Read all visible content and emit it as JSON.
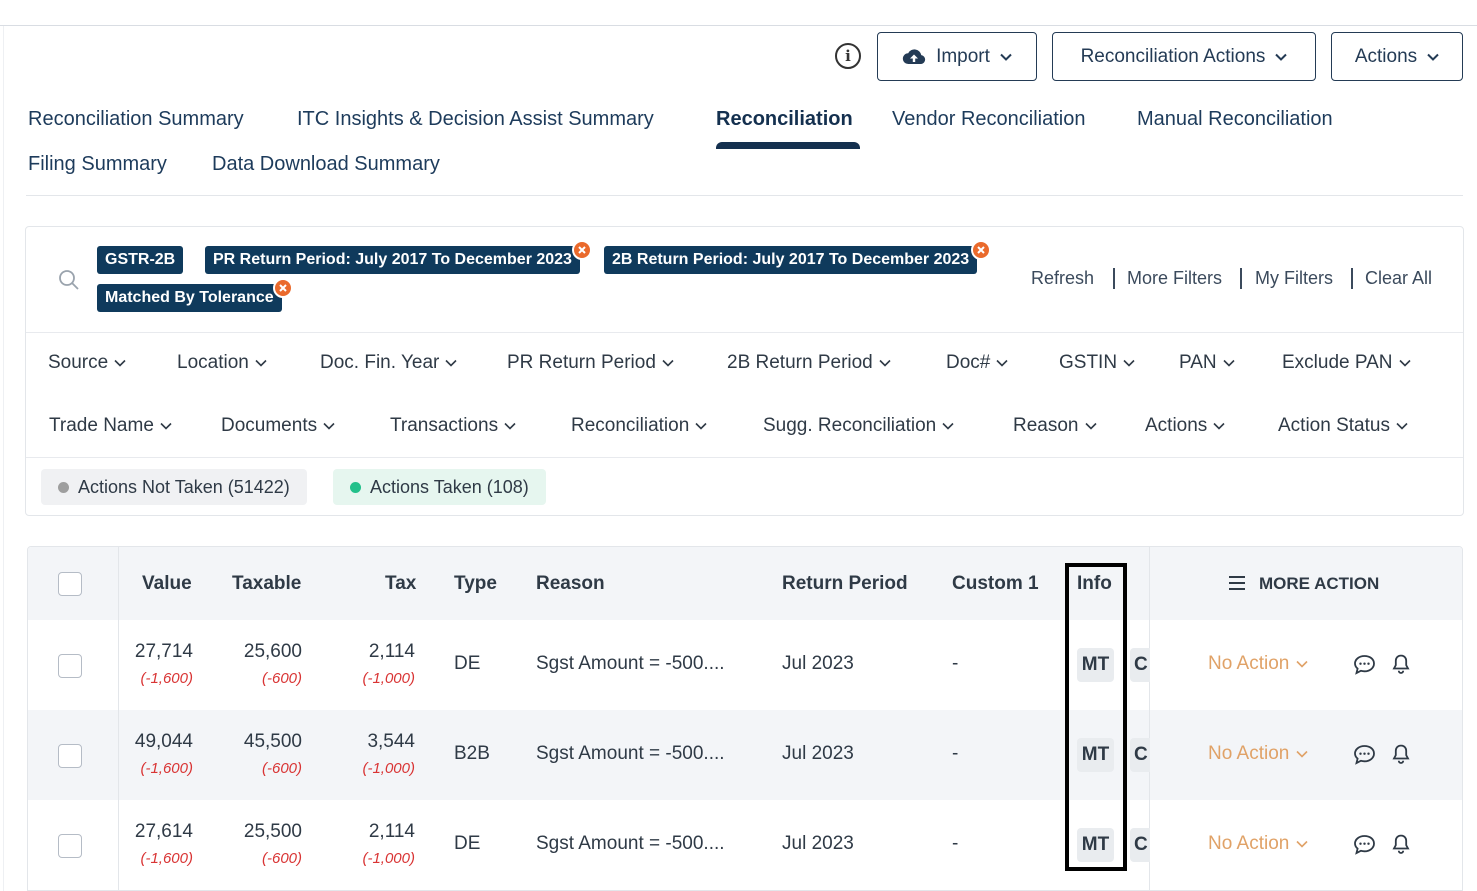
{
  "toolbar": {
    "import_label": "Import",
    "recon_actions_label": "Reconciliation Actions",
    "actions_label": "Actions",
    "info_glyph": "i"
  },
  "tabs": [
    {
      "label": "Reconciliation Summary",
      "active": false
    },
    {
      "label": "ITC Insights & Decision Assist Summary",
      "active": false
    },
    {
      "label": "Reconciliation",
      "active": true
    },
    {
      "label": "Vendor Reconciliation",
      "active": false
    },
    {
      "label": "Manual Reconciliation",
      "active": false
    },
    {
      "label": "Filing Summary",
      "active": false
    },
    {
      "label": "Data Download Summary",
      "active": false
    }
  ],
  "filter_chips": [
    {
      "label": "GSTR-2B",
      "removable": false
    },
    {
      "label": "PR Return Period: July 2017 To December 2023",
      "removable": true
    },
    {
      "label": "2B Return Period: July 2017 To December 2023",
      "removable": true
    },
    {
      "label": "Matched By Tolerance",
      "removable": true
    }
  ],
  "filter_links": [
    "Refresh",
    "More Filters",
    "My Filters",
    "Clear All"
  ],
  "filter_dropdowns_row1": [
    "Source",
    "Location",
    "Doc. Fin. Year",
    "PR Return Period",
    "2B Return Period",
    "Doc#",
    "GSTIN",
    "PAN",
    "Exclude PAN"
  ],
  "filter_dropdowns_row2": [
    "Trade Name",
    "Documents",
    "Transactions",
    "Reconciliation",
    "Sugg. Reconciliation",
    "Reason",
    "Actions",
    "Action Status"
  ],
  "status_pills": [
    {
      "label": "Actions Not Taken (51422)",
      "color": "#9e9e9e"
    },
    {
      "label": "Actions Taken (108)",
      "color": "#22c08a"
    }
  ],
  "table": {
    "columns": [
      "Value",
      "Taxable",
      "Tax",
      "Type",
      "Reason",
      "Return Period",
      "Custom 1",
      "Info",
      "MORE ACTION"
    ],
    "rows": [
      {
        "value": "27,714",
        "value_diff": "(-1,600)",
        "taxable": "25,600",
        "taxable_diff": "(-600)",
        "tax": "2,114",
        "tax_diff": "(-1,000)",
        "type": "DE",
        "reason": "Sgst Amount = -500....",
        "return_period": "Jul 2023",
        "custom1": "-",
        "info1": "MT",
        "info2": "C",
        "action": "No Action"
      },
      {
        "value": "49,044",
        "value_diff": "(-1,600)",
        "taxable": "45,500",
        "taxable_diff": "(-600)",
        "tax": "3,544",
        "tax_diff": "(-1,000)",
        "type": "B2B",
        "reason": "Sgst Amount = -500....",
        "return_period": "Jul 2023",
        "custom1": "-",
        "info1": "MT",
        "info2": "C",
        "action": "No Action"
      },
      {
        "value": "27,614",
        "value_diff": "(-1,600)",
        "taxable": "25,500",
        "taxable_diff": "(-600)",
        "tax": "2,114",
        "tax_diff": "(-1,000)",
        "type": "DE",
        "reason": "Sgst Amount = -500....",
        "return_period": "Jul 2023",
        "custom1": "-",
        "info1": "MT",
        "info2": "C",
        "action": "No Action"
      }
    ]
  }
}
